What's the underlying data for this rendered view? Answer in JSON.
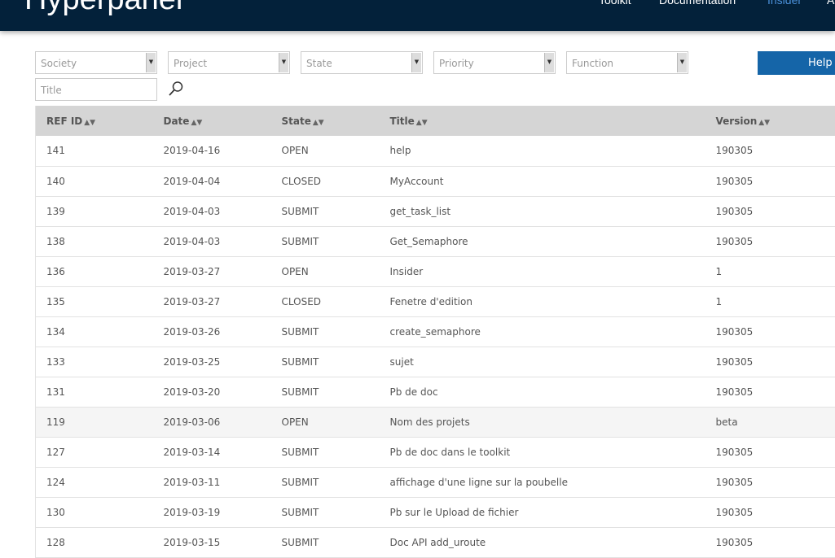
{
  "header": {
    "logo": "Hyperpanel",
    "nav": [
      "Toolkit",
      "Documentation",
      "Insider",
      "A"
    ],
    "active": "Insider"
  },
  "filters": {
    "society": "Society",
    "project": "Project",
    "state": "State",
    "priority": "Priority",
    "function": "Function",
    "title_placeholder": "Title",
    "help": "Help"
  },
  "table": {
    "columns": [
      "REF ID",
      "Date",
      "State",
      "Title",
      "Version"
    ],
    "rows": [
      [
        "141",
        "2019-04-16",
        "OPEN",
        "help",
        "190305"
      ],
      [
        "140",
        "2019-04-04",
        "CLOSED",
        "MyAccount",
        "190305"
      ],
      [
        "139",
        "2019-04-03",
        "SUBMIT",
        "get_task_list",
        "190305"
      ],
      [
        "138",
        "2019-04-03",
        "SUBMIT",
        "Get_Semaphore",
        "190305"
      ],
      [
        "136",
        "2019-03-27",
        "OPEN",
        "Insider",
        "1"
      ],
      [
        "135",
        "2019-03-27",
        "CLOSED",
        "Fenetre d'edition",
        "1"
      ],
      [
        "134",
        "2019-03-26",
        "SUBMIT",
        "create_semaphore",
        "190305"
      ],
      [
        "133",
        "2019-03-25",
        "SUBMIT",
        "sujet",
        "190305"
      ],
      [
        "131",
        "2019-03-20",
        "SUBMIT",
        "Pb de doc",
        "190305"
      ],
      [
        "119",
        "2019-03-06",
        "OPEN",
        "Nom des projets",
        "beta"
      ],
      [
        "127",
        "2019-03-14",
        "SUBMIT",
        "Pb de doc dans le toolkit",
        "190305"
      ],
      [
        "124",
        "2019-03-11",
        "SUBMIT",
        "affichage d'une ligne sur la poubelle",
        "190305"
      ],
      [
        "130",
        "2019-03-19",
        "SUBMIT",
        "Pb sur le Upload de fichier",
        "190305"
      ],
      [
        "128",
        "2019-03-15",
        "SUBMIT",
        "Doc API add_uroute",
        "190305"
      ]
    ]
  }
}
